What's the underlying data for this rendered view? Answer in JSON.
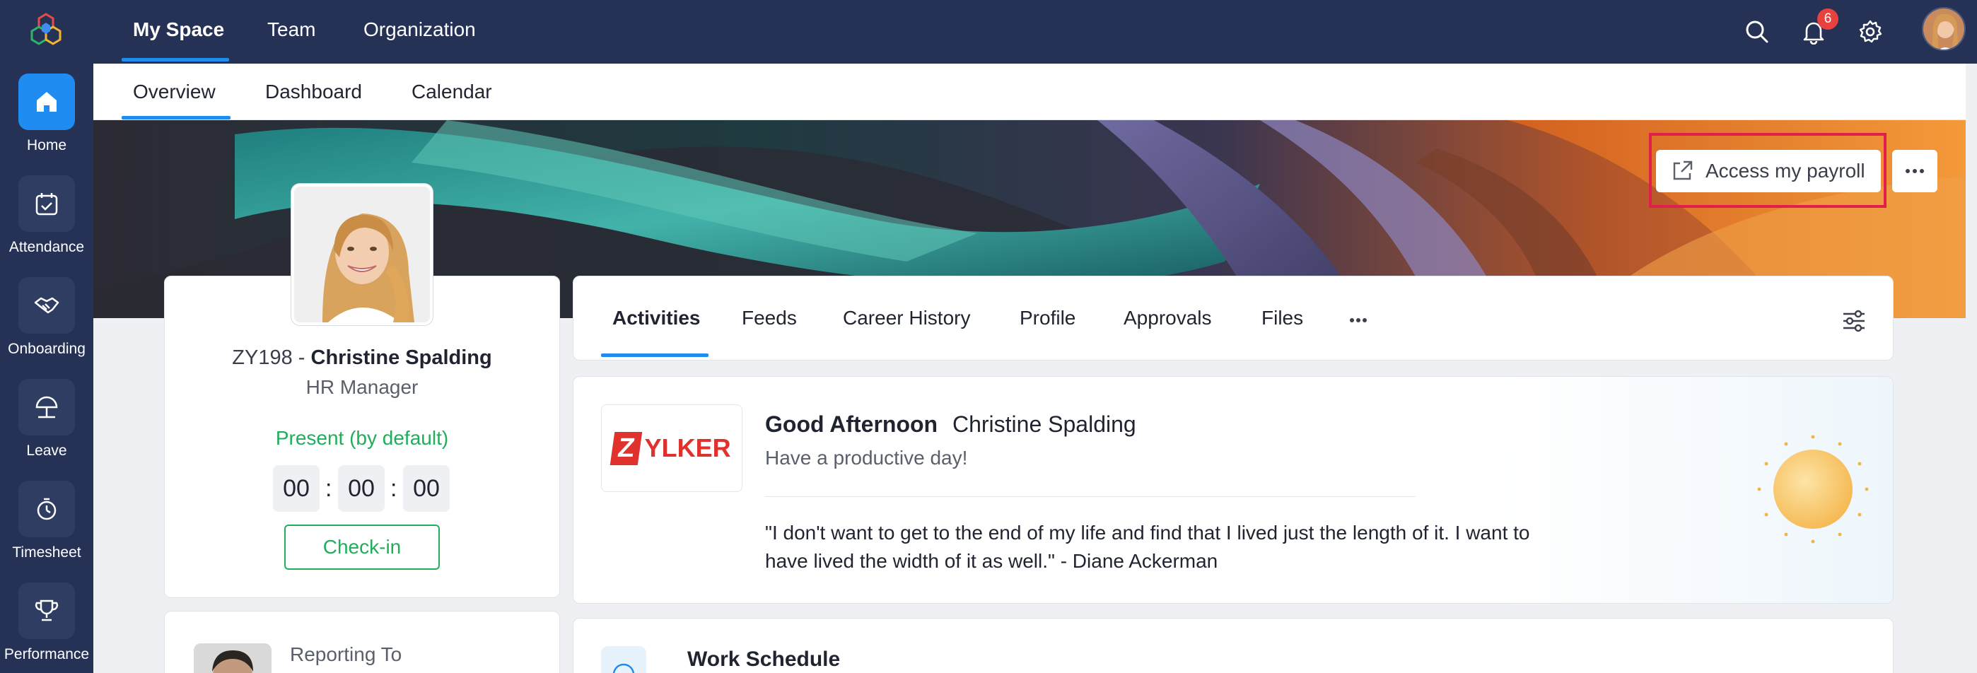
{
  "rail": {
    "items": [
      {
        "label": "Home",
        "icon": "home-icon"
      },
      {
        "label": "Attendance",
        "icon": "calendar-check-icon"
      },
      {
        "label": "Onboarding",
        "icon": "handshake-icon"
      },
      {
        "label": "Leave",
        "icon": "beach-umbrella-icon"
      },
      {
        "label": "Timesheet",
        "icon": "stopwatch-icon"
      },
      {
        "label": "Performance",
        "icon": "trophy-icon"
      }
    ]
  },
  "topnav": {
    "tabs": [
      {
        "label": "My Space"
      },
      {
        "label": "Team"
      },
      {
        "label": "Organization"
      }
    ],
    "notification_count": "6"
  },
  "subnav": {
    "tabs": [
      {
        "label": "Overview"
      },
      {
        "label": "Dashboard"
      },
      {
        "label": "Calendar"
      }
    ]
  },
  "banner": {
    "payroll_label": "Access my payroll"
  },
  "profile": {
    "id": "ZY198 -",
    "name": "Christine Spalding",
    "role": "HR Manager",
    "status": "Present (by default)",
    "timer": {
      "hours": "00",
      "minutes": "00",
      "seconds": "00"
    },
    "checkin_label": "Check-in"
  },
  "reporting": {
    "label": "Reporting To"
  },
  "activity_tabs": [
    {
      "label": "Activities"
    },
    {
      "label": "Feeds"
    },
    {
      "label": "Career History"
    },
    {
      "label": "Profile"
    },
    {
      "label": "Approvals"
    },
    {
      "label": "Files"
    }
  ],
  "greeting": {
    "salutation": "Good Afternoon",
    "name": "Christine Spalding",
    "subtitle": "Have a productive day!",
    "quote_line1": "\"I don't want to get to the end of my life and find that I lived just the length of it. I want to",
    "quote_line2": "have lived the width of it as well.\" - Diane Ackerman",
    "logo_text": "YLKER",
    "logo_letter": "Z"
  },
  "work_schedule": {
    "title": "Work Schedule"
  },
  "colors": {
    "nav_bg": "#253256",
    "accent": "#1e8cf0",
    "present": "#1fae5b",
    "highlight": "#e0204a",
    "logo_red": "#e0312d"
  }
}
